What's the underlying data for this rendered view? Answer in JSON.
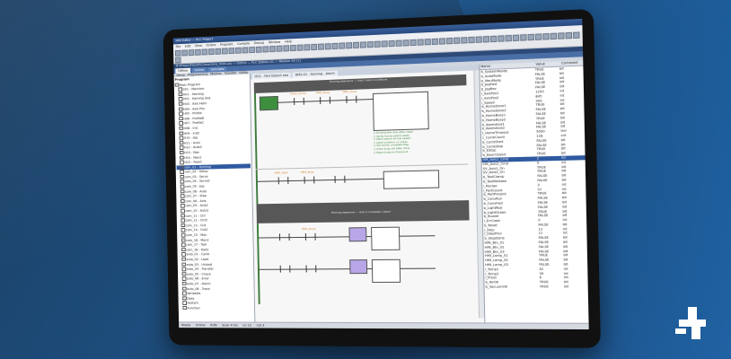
{
  "window": {
    "title": "HMI Editor — PLC Project",
    "menu": [
      "File",
      "Edit",
      "View",
      "Online",
      "Program",
      "Compile",
      "Debug",
      "Window",
      "Help"
    ],
    "path": "B:\\ProjectFiles\\PLC\\machine_main.prj — Online — PLC Station 01 — Module 30 (1)"
  },
  "tabs": {
    "main": [
      "Offline",
      "Online",
      "Simulate"
    ],
    "sub": [
      "Setup",
      "Programming",
      "Monitor",
      "Transfer",
      "Utility"
    ],
    "editor": [
      "HO1 - Part Detect seq",
      "HM2-01 - Homing - Alarm"
    ]
  },
  "tree": {
    "header": "Program",
    "items": [
      "Main Program",
      "S01 - Machine",
      "H01 - Homing",
      "H02 - Homing Seq",
      "H03 - Axis Hold",
      "H04 - Axis Pos",
      "H05 - Profile",
      "H06 - ProfileB",
      "H07 - ProfileC",
      "H08 - Init",
      "H09 - Init2",
      "H10 - Jog",
      "H11 - Auto",
      "H12 - Auto2",
      "H13 - Man",
      "H14 - Man2",
      "H15 - Reset",
      "com_01 - Homing",
      "com_02 - Setup",
      "com_03 - Servo",
      "com_04 - Servo2",
      "com_05 - Jog",
      "com_06 - Auto",
      "com_07 - Step",
      "com_08 - Axis",
      "com_09 - Axis2",
      "com_10 - Axis3",
      "com_11 - Ctrl",
      "com_12 - Ctrl2",
      "com_13 - Out",
      "com_14 - Out2",
      "com_15 - Mon",
      "com_16 - Mon2",
      "com_17 - Tool",
      "com_18 - Tool2",
      "auto_01 - Cycle",
      "auto_02 - Load",
      "auto_03 - Unload",
      "auto_04 - Transfer",
      "auto_05 - Check",
      "auto_06 - Error",
      "auto_07 - Alarm",
      "auto_08 - Trace",
      "Variables",
      "Data",
      "System",
      "Function"
    ]
  },
  "rungs": {
    "header1": "Homing sequence — Axis 1 start conditions",
    "header2": "Homing sequence — Axis 2 complete / alarm",
    "labels": [
      "Axis1_Home",
      "HM1_Busy",
      "HM1_Done",
      "HM2_Start",
      "HM2_Busy",
      "HM2_Done"
    ],
    "comment_lines": [
      "// Homing the axis after reset",
      "// Verify home switch state",
      "// Start search at low speed",
      "// Latch position on index",
      "// Set home complete flag",
      "// Clear busy bit after done",
      "// Report alarm if timeout"
    ]
  },
  "variables": {
    "columns": [
      "Name",
      "Value",
      "Comment"
    ],
    "rows": [
      {
        "name": "b_SystemReady",
        "value": "TRUE",
        "comment": "bit"
      },
      {
        "name": "b_AutoMode",
        "value": "FALSE",
        "comment": "bit"
      },
      {
        "name": "b_ManMode",
        "value": "TRUE",
        "comment": "bit"
      },
      {
        "name": "b_JogFwd",
        "value": "FALSE",
        "comment": "bit"
      },
      {
        "name": "b_JogRev",
        "value": "FALSE",
        "comment": "bit"
      },
      {
        "name": "i_AxisPos1",
        "value": "1250",
        "comment": "int"
      },
      {
        "name": "i_AxisPos2",
        "value": "845",
        "comment": "int"
      },
      {
        "name": "i_Speed",
        "value": "300",
        "comment": "int"
      },
      {
        "name": "b_HomeDone1",
        "value": "TRUE",
        "comment": "bit"
      },
      {
        "name": "b_HomeDone2",
        "value": "FALSE",
        "comment": "bit"
      },
      {
        "name": "b_HomeBusy1",
        "value": "FALSE",
        "comment": "bit"
      },
      {
        "name": "b_HomeBusy2",
        "value": "TRUE",
        "comment": "bit"
      },
      {
        "name": "b_AlarmAxis1",
        "value": "FALSE",
        "comment": "bit"
      },
      {
        "name": "b_AlarmAxis2",
        "value": "FALSE",
        "comment": "bit"
      },
      {
        "name": "t_HomeTimeout",
        "value": "5000",
        "comment": "tmr"
      },
      {
        "name": "c_CycleCount",
        "value": "128",
        "comment": "cnt"
      },
      {
        "name": "b_CycleStart",
        "value": "FALSE",
        "comment": "bit"
      },
      {
        "name": "b_CycleStop",
        "value": "FALSE",
        "comment": "bit"
      },
      {
        "name": "b_EStop",
        "value": "TRUE",
        "comment": "bit"
      },
      {
        "name": "b_DoorClosed",
        "value": "TRUE",
        "comment": "bit"
      },
      {
        "name": "HM_Axis1_Cmd",
        "value": "2",
        "comment": "int"
      },
      {
        "name": "HM_Axis2_Cmd",
        "value": "0",
        "comment": "int"
      },
      {
        "name": "SV_Axis1_On",
        "value": "TRUE",
        "comment": "bit"
      },
      {
        "name": "SV_Axis2_On",
        "value": "TRUE",
        "comment": "bit"
      },
      {
        "name": "b_ToolClamp",
        "value": "FALSE",
        "comment": "bit"
      },
      {
        "name": "b_ToolRelease",
        "value": "FALSE",
        "comment": "bit"
      },
      {
        "name": "i_Recipe",
        "value": "3",
        "comment": "int"
      },
      {
        "name": "i_PartCount",
        "value": "57",
        "comment": "int"
      },
      {
        "name": "b_PartPresent",
        "value": "TRUE",
        "comment": "bit"
      },
      {
        "name": "b_ConvRun",
        "value": "FALSE",
        "comment": "bit"
      },
      {
        "name": "b_ConvFwd",
        "value": "FALSE",
        "comment": "bit"
      },
      {
        "name": "b_LightRed",
        "value": "FALSE",
        "comment": "bit"
      },
      {
        "name": "b_LightGreen",
        "value": "TRUE",
        "comment": "bit"
      },
      {
        "name": "b_Buzzer",
        "value": "FALSE",
        "comment": "bit"
      },
      {
        "name": "i_ErrCode",
        "value": "0",
        "comment": "int"
      },
      {
        "name": "b_Reset",
        "value": "FALSE",
        "comment": "bit"
      },
      {
        "name": "i_Step",
        "value": "12",
        "comment": "int"
      },
      {
        "name": "i_StepPrev",
        "value": "11",
        "comment": "int"
      },
      {
        "name": "b_StepDone",
        "value": "FALSE",
        "comment": "bit"
      },
      {
        "name": "HMI_Btn_01",
        "value": "FALSE",
        "comment": "bit"
      },
      {
        "name": "HMI_Btn_02",
        "value": "FALSE",
        "comment": "bit"
      },
      {
        "name": "HMI_Btn_03",
        "value": "FALSE",
        "comment": "bit"
      },
      {
        "name": "HMI_Lamp_01",
        "value": "TRUE",
        "comment": "bit"
      },
      {
        "name": "HMI_Lamp_02",
        "value": "FALSE",
        "comment": "bit"
      },
      {
        "name": "HMI_Lamp_03",
        "value": "FALSE",
        "comment": "bit"
      },
      {
        "name": "i_Temp1",
        "value": "42",
        "comment": "int"
      },
      {
        "name": "i_Temp2",
        "value": "39",
        "comment": "int"
      },
      {
        "name": "i_Press",
        "value": "6",
        "comment": "int"
      },
      {
        "name": "b_AirOK",
        "value": "TRUE",
        "comment": "bit"
      },
      {
        "name": "b_VacuumOK",
        "value": "TRUE",
        "comment": "bit"
      }
    ]
  },
  "status": [
    "Ready",
    "Online",
    "RUN",
    "Scan 4 ms",
    "Ln 12",
    "Col 3"
  ]
}
